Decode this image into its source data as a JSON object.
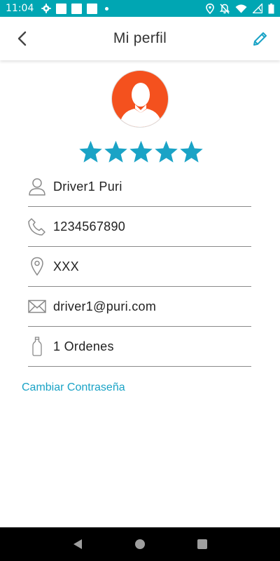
{
  "status_bar": {
    "time": "11:04"
  },
  "header": {
    "title": "Mi perfil",
    "accent_color": "#1aa3c6"
  },
  "profile": {
    "rating": 5,
    "rating_max": 5,
    "star_color": "#1aa3c6",
    "fields": [
      {
        "icon": "person-icon",
        "value": "Driver1 Puri"
      },
      {
        "icon": "phone-icon",
        "value": "1234567890"
      },
      {
        "icon": "location-pin-icon",
        "value": "XXX"
      },
      {
        "icon": "mail-icon",
        "value": "driver1@puri.com"
      },
      {
        "icon": "bottle-icon",
        "value": "1 Ordenes"
      }
    ]
  },
  "actions": {
    "change_password": "Cambiar Contraseña"
  },
  "colors": {
    "status_bar": "#00a6b3",
    "avatar_bg": "#f4511e",
    "link": "#1aa3c6"
  }
}
